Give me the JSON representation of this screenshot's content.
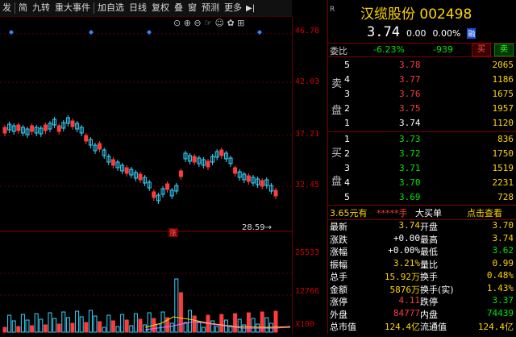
{
  "toolbar": {
    "items": [
      "发",
      "简",
      "九转",
      "重大事件",
      "加自选",
      "日线",
      "复权",
      "叠",
      "窗",
      "预测",
      "更多"
    ],
    "play_icon": "▶|"
  },
  "chart": {
    "price_ticks": [
      "46.78",
      "42.03",
      "37.21",
      "32.45",
      "28.59"
    ],
    "volume_ticks": [
      "25533",
      "12766",
      "X100"
    ],
    "low_marker": "28.59",
    "limit_up_marker": "涨",
    "icon_row": "⊙ ⊕ ⊖ ☞ ☺ ✿ ⊞"
  },
  "quote": {
    "name": "汉缆股份",
    "code": "002498",
    "badge": "R",
    "price": "3.74",
    "change": "0.00",
    "change_pct": "0.00%",
    "exchange_badge": "融"
  },
  "weibi": {
    "label": "委比",
    "value": "-6.23%",
    "diff": "-939",
    "buy_btn": "买",
    "sell_btn": "卖"
  },
  "sell_book": [
    {
      "lvl": "5",
      "price": "3.78",
      "vol": "2065"
    },
    {
      "lvl": "4",
      "price": "3.77",
      "vol": "1186"
    },
    {
      "lvl": "3",
      "price": "3.76",
      "vol": "1675"
    },
    {
      "lvl": "2",
      "price": "3.75",
      "vol": "1957"
    },
    {
      "lvl": "1",
      "price": "3.74",
      "vol": "1120"
    }
  ],
  "sell_label": [
    "卖",
    "盘"
  ],
  "buy_book": [
    {
      "lvl": "1",
      "price": "3.73",
      "vol": "836"
    },
    {
      "lvl": "2",
      "price": "3.72",
      "vol": "1750"
    },
    {
      "lvl": "3",
      "price": "3.71",
      "vol": "1519"
    },
    {
      "lvl": "4",
      "price": "3.70",
      "vent": "",
      "vol": "2231"
    },
    {
      "lvl": "5",
      "price": "3.69",
      "vol": "728"
    }
  ],
  "buy_label": [
    "买",
    "盘"
  ],
  "big_order": {
    "price": "3.65元有",
    "stars": "*****手",
    "text": "大买单",
    "link": "点击查看"
  },
  "stats": [
    {
      "l1": "最新",
      "v1": "3.74",
      "l2": "开盘",
      "v2": "3.70"
    },
    {
      "l1": "涨跌",
      "v1": "+0.00",
      "l2": "最高",
      "v2": "3.74"
    },
    {
      "l1": "涨幅",
      "v1": "+0.00%",
      "l2": "最低",
      "v2": "3.62"
    },
    {
      "l1": "振幅",
      "v1": "3.21%",
      "l2": "量比",
      "v2": "0.99"
    },
    {
      "l1": "总手",
      "v1": "15.92万",
      "l2": "换手",
      "v2": "0.48%"
    },
    {
      "l1": "金额",
      "v1": "5876万",
      "l2": "换手(实)",
      "v2": "1.43%"
    },
    {
      "l1": "涨停",
      "v1": "4.11",
      "l2": "跌停",
      "v2": "3.37"
    },
    {
      "l1": "外盘",
      "v1": "84777",
      "l2": "内盘",
      "v2": "74439"
    },
    {
      "l1": "总市值",
      "v1": "124.4亿",
      "l2": "流通值",
      "v2": "124.4亿"
    }
  ]
}
